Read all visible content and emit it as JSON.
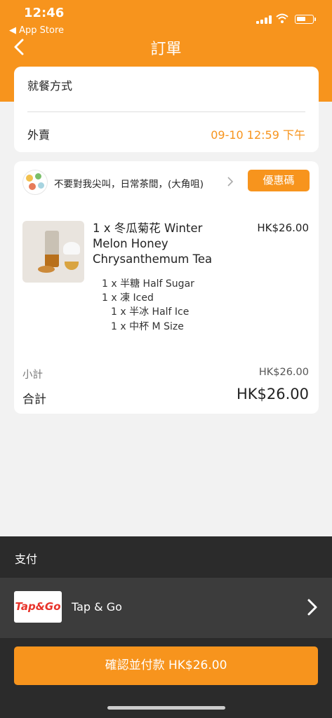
{
  "status_bar": {
    "time": "12:46",
    "back_app": "◀ App Store"
  },
  "nav": {
    "title": "訂單"
  },
  "dining": {
    "label": "就餐方式",
    "mode": "外賣",
    "time": "09-10 12:59 下午"
  },
  "order": {
    "shop_name": "不要對我尖叫，日常茶間，(大角咀)",
    "coupon_label": "優惠碼",
    "item": {
      "name": "1 x 冬瓜菊花 Winter Melon Honey Chrysanthemum Tea",
      "price": "HK$26.00",
      "options": [
        "1 x 半糖 Half Sugar",
        "1 x 凍 Iced",
        "1 x 半冰 Half Ice",
        "1 x 中杯 M Size"
      ]
    },
    "subtotal_label": "小計",
    "subtotal_value": "HK$26.00",
    "total_label": "合計",
    "total_value": "HK$26.00"
  },
  "payment": {
    "title": "支付",
    "method_logo_text": "Tap&Go",
    "method_name": "Tap & Go",
    "confirm_label": "確認並付款  HK$26.00"
  },
  "colors": {
    "accent": "#f7941d",
    "pay_panel": "#2b2b2b",
    "pay_row": "#3c3c3c",
    "logo_red": "#e8332a"
  },
  "icons": [
    "signal-icon",
    "wifi-icon",
    "battery-icon",
    "back-arrow-icon",
    "chevron-right-icon"
  ]
}
